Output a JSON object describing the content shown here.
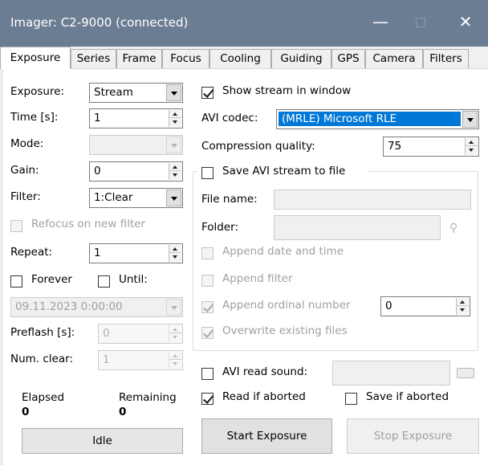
{
  "window": {
    "title": "Imager: C2-9000 (connected)",
    "min": "—",
    "close": "✕"
  },
  "tabs": [
    "Exposure",
    "Series",
    "Frame",
    "Focus",
    "Cooling",
    "Guiding",
    "GPS",
    "Camera",
    "Filters"
  ],
  "left": {
    "exposure_label": "Exposure:",
    "exposure_value": "Stream",
    "time_label": "Time [s]:",
    "time_value": "1",
    "mode_label": "Mode:",
    "mode_value": "",
    "gain_label": "Gain:",
    "gain_value": "0",
    "filter_label": "Filter:",
    "filter_value": "1:Clear",
    "refocus_label": "Refocus on new filter",
    "repeat_label": "Repeat:",
    "repeat_value": "1",
    "forever_label": "Forever",
    "until_label": "Until:",
    "until_datetime": "09.11.2023  0:00:00",
    "preflash_label": "Preflash [s]:",
    "preflash_value": "0",
    "numclear_label": "Num. clear:",
    "numclear_value": "1",
    "elapsed_label": "Elapsed",
    "elapsed_value": "0",
    "remaining_label": "Remaining",
    "remaining_value": "0",
    "status": "Idle"
  },
  "right": {
    "show_stream_label": "Show stream in window",
    "show_stream_checked": true,
    "avi_codec_label": "AVI codec:",
    "avi_codec_value": "(MRLE) Microsoft RLE",
    "compression_label": "Compression quality:",
    "compression_value": "75",
    "save_avi_label": "Save AVI stream to file",
    "file_name_label": "File name:",
    "folder_label": "Folder:",
    "append_date_label": "Append date and time",
    "append_filter_label": "Append filter",
    "append_ordinal_label": "Append ordinal number",
    "append_ordinal_value": "0",
    "overwrite_label": "Overwrite existing files",
    "avi_read_sound_label": "AVI read sound:",
    "read_if_aborted_label": "Read if aborted",
    "read_if_aborted_checked": true,
    "save_if_aborted_label": "Save if aborted",
    "start_button": "Start Exposure",
    "stop_button": "Stop Exposure"
  },
  "colors": {
    "titlebar": "#6b7d93",
    "highlight": "#0078d7"
  }
}
